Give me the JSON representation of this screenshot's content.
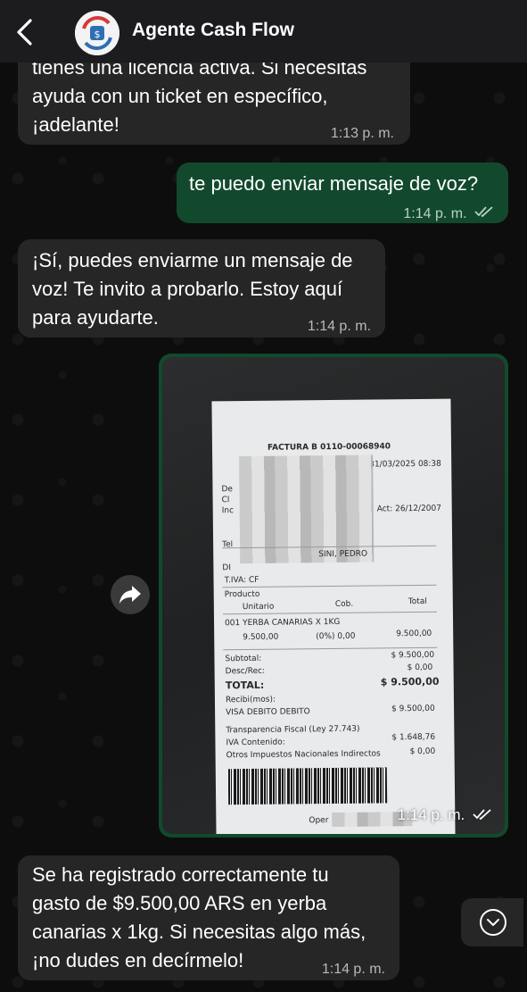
{
  "header": {
    "title": "Agente Cash Flow",
    "back_icon": "chevron-left-icon",
    "avatar_icon": "cash-flow-logo"
  },
  "colors": {
    "header_bg": "#1c1c1e",
    "incoming_bubble": "#262626",
    "outgoing_bubble": "#12492c",
    "timestamp": "#b9b9b9"
  },
  "messages": [
    {
      "direction": "in",
      "lines": [
        "tienes una licencia activa. Si necesitas",
        "ayuda con un ticket en específico,",
        "¡adelante!"
      ],
      "time": "1:13 p. m."
    },
    {
      "direction": "out",
      "lines": [
        "te puedo enviar mensaje de voz?"
      ],
      "time": "1:14 p. m.",
      "read_ticks": "double-check-icon"
    },
    {
      "direction": "in",
      "lines": [
        "¡Sí, puedes enviarme un mensaje de",
        "voz! Te invito a probarlo. Estoy aquí",
        "para ayudarte."
      ],
      "time": "1:14 p. m."
    },
    {
      "direction": "out",
      "type": "image",
      "time": "1:14 p. m.",
      "read_ticks": "double-check-icon",
      "receipt": {
        "title": "FACTURA B 0110-00068940",
        "date_time": "31/03/2025 08:38",
        "labels_left": [
          "De",
          "Cl",
          "Inc"
        ],
        "act": "Act: 26/12/2007",
        "tel": "Tel",
        "client_name": "SINI, PEDRO",
        "di": "DI",
        "tiva": "T.IVA: CF",
        "col_producto": "Producto",
        "col_unitario": "Unitario",
        "col_cob": "Cob.",
        "col_total": "Total",
        "item_name": "001 YERBA CANARIAS X 1KG",
        "item_unit": "9.500,00",
        "item_cob": "(0%) 0,00",
        "item_total": "9.500,00",
        "subtotal_label": "Subtotal:",
        "subtotal_value": "$ 9.500,00",
        "desc_label": "Desc/Rec:",
        "desc_value": "$ 0,00",
        "total_label": "TOTAL:",
        "total_value": "$ 9.500,00",
        "recibi_label": "Recibi(mos):",
        "payment_label": "VISA DEBITO DEBITO",
        "payment_value": "$ 9.500,00",
        "transparencia": "Transparencia Fiscal (Ley 27.743)",
        "iva_label": "IVA Contenido:",
        "iva_value": "$ 1.648,76",
        "otros_label": "Otros Impuestos Nacionales Indirectos",
        "otros_value": "$ 0,00",
        "oper": "Oper"
      }
    },
    {
      "direction": "in",
      "lines": [
        "Se ha registrado correctamente tu",
        "gasto de $9.500,00 ARS en yerba",
        "canarias x 1kg. Si necesitas algo más,",
        "¡no dudes en decírmelo!"
      ],
      "time": "1:14 p. m."
    }
  ],
  "forward_icon": "forward-arrow-icon",
  "scroll_down_icon": "chevron-down-circle-icon"
}
